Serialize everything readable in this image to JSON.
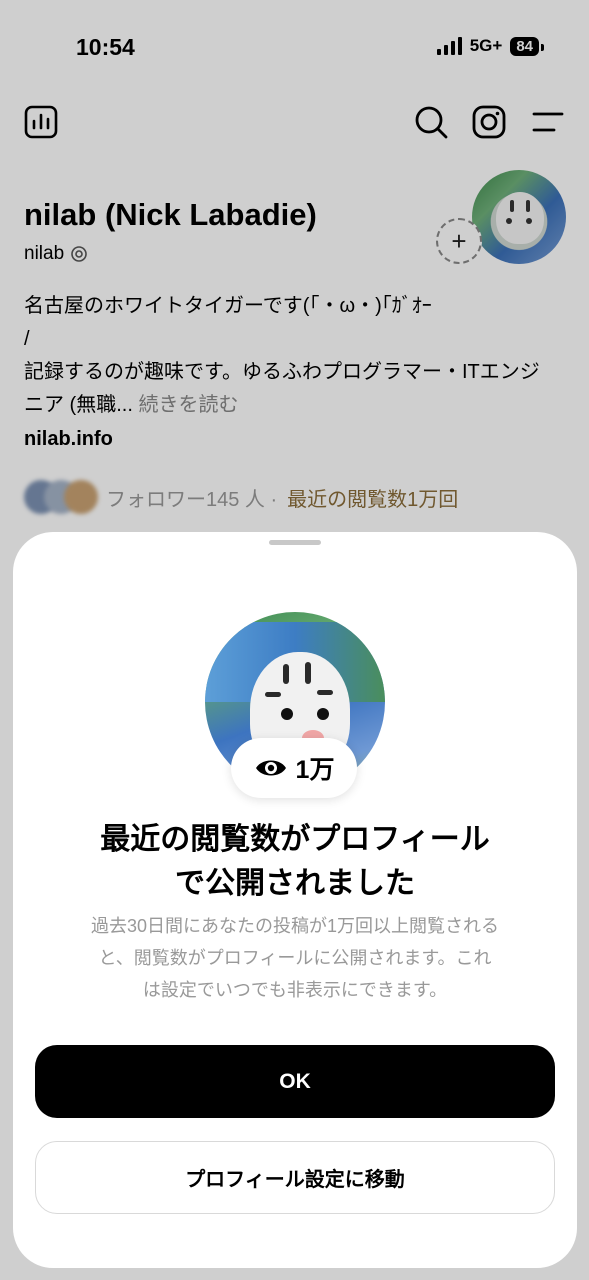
{
  "status_bar": {
    "time": "10:54",
    "network": "5G+",
    "battery": "84"
  },
  "top_icons": [
    "insights-icon",
    "search-icon",
    "instagram-icon",
    "menu-icon"
  ],
  "profile": {
    "name": "nilab (Nick Labadie)",
    "username": "nilab",
    "bio_line1": "名古屋のホワイトタイガーです(「・ω・)｢ｶﾞｵｰ",
    "bio_line2": "/",
    "bio_line3": "記録するのが趣味です。ゆるふわプログラマー・ITエンジ",
    "bio_line4": "ニア (無職...",
    "bio_more": "続きを読む",
    "link": "nilab.info",
    "followers": "フォロワー145 人 ·",
    "views": "最近の閲覧数1万回"
  },
  "sheet": {
    "views_badge": "1万",
    "title_line1": "最近の閲覧数がプロフィール",
    "title_line2": "で公開されました",
    "desc_line1": "過去30日間にあなたの投稿が1万回以上閲覧される",
    "desc_line2": "と、閲覧数がプロフィールに公開されます。これ",
    "desc_line3": "は設定でいつでも非表示にできます。",
    "ok_label": "OK",
    "settings_label": "プロフィール設定に移動"
  },
  "colors": {
    "primary_button": "#000000",
    "views_accent": "#8a6d3b",
    "secondary_text": "#999999"
  }
}
